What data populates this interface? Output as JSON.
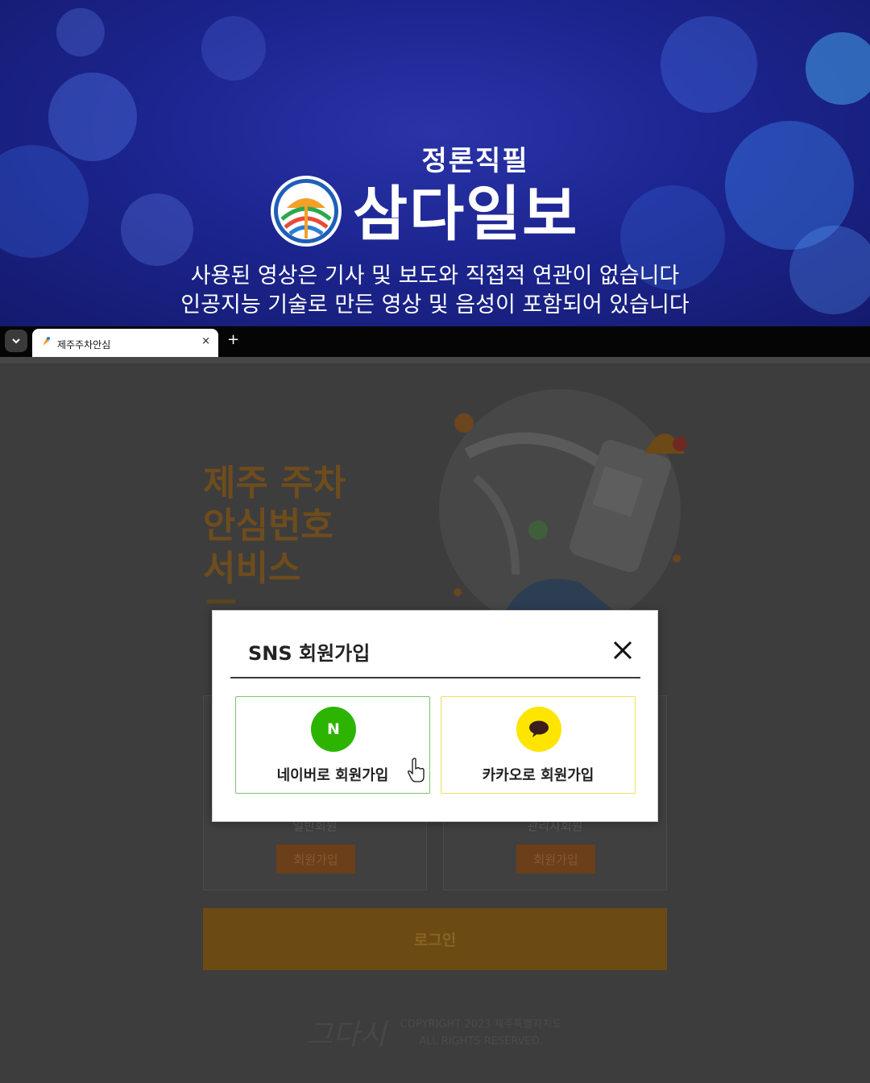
{
  "banner": {
    "slogan": "정론직필",
    "brand": "삼다일보",
    "disclaimer_line1": "사용된 영상은 기사 및 보도와 직접적 연관이 없습니다",
    "disclaimer_line2": "인공지능 기술로 만든 영상 및 음성이 포함되어 있습니다"
  },
  "browser": {
    "tab_title": "제주주차안심",
    "tab_close": "×",
    "new_tab": "+",
    "tab_menu_icon": "chevron-down-icon"
  },
  "page": {
    "hero_title_lines": [
      "제주 주차",
      "안심번호",
      "서비스"
    ],
    "member_cards": [
      {
        "label": "일반회원",
        "signup_label": "회원가입"
      },
      {
        "label": "관리자회원",
        "signup_label": "회원가입"
      }
    ],
    "login_label": "로그인",
    "footer_logo": "그다시",
    "footer_copyright_line1": "COPYRIGHT 2023 제주특별자치도",
    "footer_copyright_line2": "ALL RIGHTS RESERVED."
  },
  "modal": {
    "title": "SNS 회원가입",
    "close_icon": "close-icon",
    "naver": {
      "icon_text": "N",
      "label": "네이버로 회원가입",
      "color": "#2db400"
    },
    "kakao": {
      "icon": "speech-bubble-icon",
      "label": "카카오로 회원가입",
      "color": "#fee500"
    }
  },
  "colors": {
    "banner_bg": "#1c2590",
    "overlay_page": "#3d3d3d",
    "accent_orange": "#6c4a14"
  }
}
